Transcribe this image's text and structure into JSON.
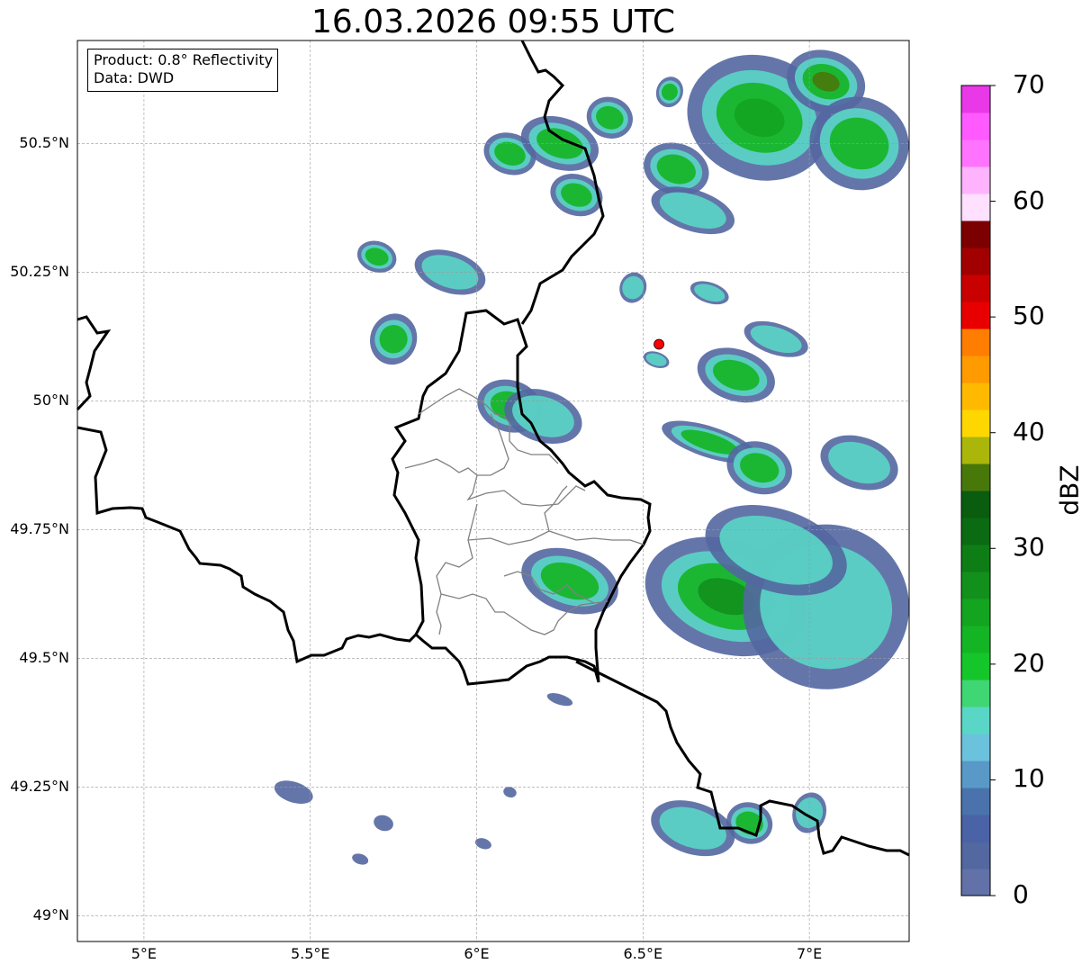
{
  "title": "16.03.2026 09:55 UTC",
  "info": {
    "product": "Product: 0.8° Reflectivity",
    "source": "Data: DWD"
  },
  "map": {
    "extent": {
      "lon_min": 4.8,
      "lon_max": 7.3,
      "lat_min": 48.95,
      "lat_max": 50.7
    },
    "lat_ticks": [
      {
        "lat": 50.5,
        "label": "50.5°N"
      },
      {
        "lat": 50.25,
        "label": "50.25°N"
      },
      {
        "lat": 50.0,
        "label": "50°N"
      },
      {
        "lat": 49.75,
        "label": "49.75°N"
      },
      {
        "lat": 49.5,
        "label": "49.5°N"
      },
      {
        "lat": 49.25,
        "label": "49.25°N"
      },
      {
        "lat": 49.0,
        "label": "49°N"
      }
    ],
    "lon_ticks": [
      {
        "lon": 5.0,
        "label": "5°E"
      },
      {
        "lon": 5.5,
        "label": "5.5°E"
      },
      {
        "lon": 6.0,
        "label": "6°E"
      },
      {
        "lon": 6.5,
        "label": "6.5°E"
      },
      {
        "lon": 7.0,
        "label": "7°E"
      }
    ],
    "radar_site": {
      "lon": 6.548,
      "lat": 50.11,
      "color": "#ff0000"
    }
  },
  "colorbar": {
    "title": "dBZ",
    "min": 0,
    "max": 70,
    "ticks": [
      "0",
      "10",
      "20",
      "30",
      "40",
      "50",
      "60",
      "70"
    ],
    "colors": [
      "#6272a8",
      "#5367a0",
      "#4a62a6",
      "#4a73ad",
      "#5899c8",
      "#6bc2dc",
      "#5ad6c6",
      "#3ed773",
      "#14c62a",
      "#14b524",
      "#13a420",
      "#12901c",
      "#0e7d16",
      "#0b6b12",
      "#0a5c0f",
      "#48780a",
      "#aab60a",
      "#ffd700",
      "#ffba00",
      "#ff9a00",
      "#ff7d00",
      "#e80000",
      "#c80000",
      "#a20000",
      "#7c0000",
      "#ffe0ff",
      "#ffb3ff",
      "#ff73ff",
      "#ff5aff",
      "#e838e8"
    ]
  },
  "echoes": [
    {
      "lon": 6.85,
      "lat": 50.55,
      "rx": 0.22,
      "ry": 0.12,
      "level": 24
    },
    {
      "lon": 7.05,
      "lat": 50.62,
      "rx": 0.12,
      "ry": 0.06,
      "level": 36
    },
    {
      "lon": 7.15,
      "lat": 50.5,
      "rx": 0.15,
      "ry": 0.09,
      "level": 22
    },
    {
      "lon": 6.1,
      "lat": 50.48,
      "rx": 0.08,
      "ry": 0.04,
      "level": 18
    },
    {
      "lon": 6.25,
      "lat": 50.5,
      "rx": 0.12,
      "ry": 0.05,
      "level": 20
    },
    {
      "lon": 6.4,
      "lat": 50.55,
      "rx": 0.07,
      "ry": 0.04,
      "level": 22
    },
    {
      "lon": 6.6,
      "lat": 50.45,
      "rx": 0.1,
      "ry": 0.05,
      "level": 18
    },
    {
      "lon": 6.65,
      "lat": 50.37,
      "rx": 0.13,
      "ry": 0.04,
      "level": 16
    },
    {
      "lon": 6.3,
      "lat": 50.4,
      "rx": 0.08,
      "ry": 0.04,
      "level": 20
    },
    {
      "lon": 5.92,
      "lat": 50.25,
      "rx": 0.11,
      "ry": 0.04,
      "level": 16
    },
    {
      "lon": 5.75,
      "lat": 50.12,
      "rx": 0.07,
      "ry": 0.05,
      "level": 22
    },
    {
      "lon": 5.7,
      "lat": 50.28,
      "rx": 0.06,
      "ry": 0.03,
      "level": 18
    },
    {
      "lon": 6.1,
      "lat": 49.99,
      "rx": 0.1,
      "ry": 0.05,
      "level": 22
    },
    {
      "lon": 6.2,
      "lat": 49.97,
      "rx": 0.12,
      "ry": 0.05,
      "level": 14
    },
    {
      "lon": 6.78,
      "lat": 50.05,
      "rx": 0.12,
      "ry": 0.05,
      "level": 20
    },
    {
      "lon": 6.9,
      "lat": 50.12,
      "rx": 0.1,
      "ry": 0.03,
      "level": 14
    },
    {
      "lon": 6.7,
      "lat": 49.92,
      "rx": 0.15,
      "ry": 0.03,
      "level": 20
    },
    {
      "lon": 6.85,
      "lat": 49.87,
      "rx": 0.1,
      "ry": 0.05,
      "level": 18
    },
    {
      "lon": 7.15,
      "lat": 49.88,
      "rx": 0.12,
      "ry": 0.05,
      "level": 14
    },
    {
      "lon": 6.75,
      "lat": 49.62,
      "rx": 0.25,
      "ry": 0.11,
      "level": 26
    },
    {
      "lon": 7.05,
      "lat": 49.6,
      "rx": 0.25,
      "ry": 0.16,
      "level": 12
    },
    {
      "lon": 6.9,
      "lat": 49.71,
      "rx": 0.22,
      "ry": 0.08,
      "level": 14
    },
    {
      "lon": 6.28,
      "lat": 49.65,
      "rx": 0.15,
      "ry": 0.06,
      "level": 22
    },
    {
      "lon": 6.65,
      "lat": 49.17,
      "rx": 0.13,
      "ry": 0.05,
      "level": 16
    },
    {
      "lon": 6.82,
      "lat": 49.18,
      "rx": 0.07,
      "ry": 0.04,
      "level": 18
    },
    {
      "lon": 7.0,
      "lat": 49.2,
      "rx": 0.05,
      "ry": 0.04,
      "level": 12
    },
    {
      "lon": 5.45,
      "lat": 49.24,
      "rx": 0.06,
      "ry": 0.02,
      "level": 4
    },
    {
      "lon": 5.72,
      "lat": 49.18,
      "rx": 0.03,
      "ry": 0.015,
      "level": 4
    },
    {
      "lon": 5.65,
      "lat": 49.11,
      "rx": 0.025,
      "ry": 0.01,
      "level": 4
    },
    {
      "lon": 6.02,
      "lat": 49.14,
      "rx": 0.025,
      "ry": 0.01,
      "level": 4
    },
    {
      "lon": 6.1,
      "lat": 49.24,
      "rx": 0.02,
      "ry": 0.01,
      "level": 6
    },
    {
      "lon": 6.25,
      "lat": 49.42,
      "rx": 0.04,
      "ry": 0.01,
      "level": 6
    },
    {
      "lon": 6.54,
      "lat": 50.08,
      "rx": 0.04,
      "ry": 0.015,
      "level": 12
    },
    {
      "lon": 6.7,
      "lat": 50.21,
      "rx": 0.06,
      "ry": 0.02,
      "level": 12
    },
    {
      "lon": 6.47,
      "lat": 50.22,
      "rx": 0.04,
      "ry": 0.03,
      "level": 16
    },
    {
      "lon": 6.58,
      "lat": 50.6,
      "rx": 0.04,
      "ry": 0.03,
      "level": 20
    }
  ]
}
